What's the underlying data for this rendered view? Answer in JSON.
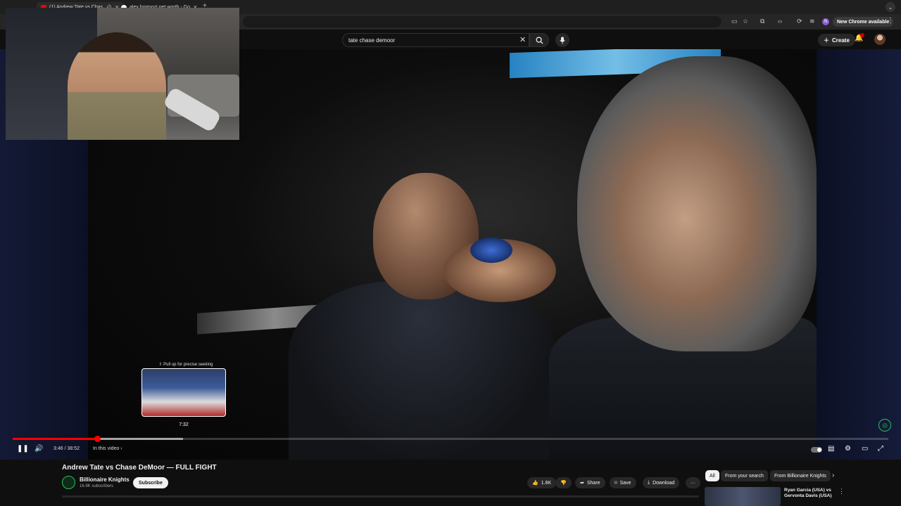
{
  "browser": {
    "tabs": [
      {
        "label": "(1) Andrew Tate vs Chas",
        "icon": "youtube-icon",
        "color": "#ff0000",
        "active": true
      },
      {
        "label": "alex hormozi net worth - Go",
        "icon": "google-icon",
        "color": "#ffffff",
        "active": false
      }
    ],
    "new_tab": "+",
    "update_label": "New Chrome available",
    "profile_initial": "N",
    "menu": "⋮"
  },
  "youtube": {
    "search_value": "tate chase demoor",
    "create_label": "Create"
  },
  "player": {
    "seek_hint": "⇧ Pull up for precise seeking",
    "seek_time": "7:32",
    "time_display": "3:46 / 38:52",
    "chapter_label": "In this video",
    "progress": {
      "played_fraction": 0.0971,
      "hover_fraction": 0.1943
    }
  },
  "video": {
    "title": "Andrew Tate vs Chase DeMoor — FULL FIGHT",
    "channel_name": "Billionaire Knights",
    "subscribers": "16.9K subscribers",
    "subscribe_label": "Subscribe",
    "like_count": "1.8K",
    "share_label": "Share",
    "save_label": "Save",
    "download_label": "Download",
    "more": "···"
  },
  "recommendations": {
    "chips": [
      "All",
      "From your search",
      "From Billionaire Knights"
    ],
    "first_title": "Ryan Garcia (USA) vs Gervonta Davis (USA)"
  },
  "colors": {
    "accent": "#ff0000",
    "brand_green": "#22c55e"
  }
}
